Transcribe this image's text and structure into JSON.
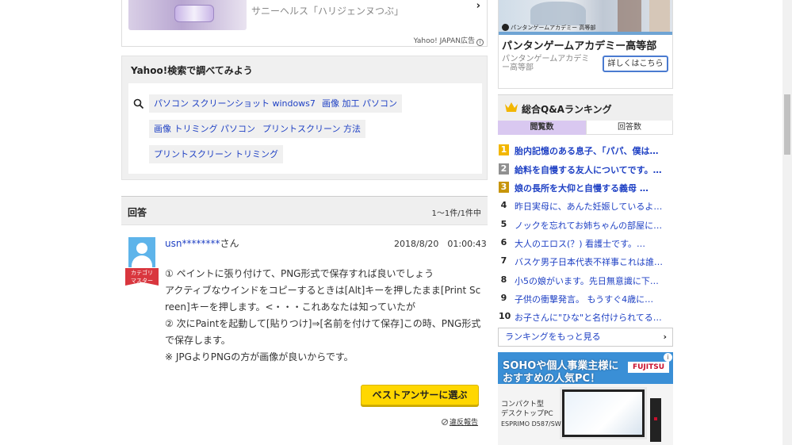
{
  "top_ad": {
    "text": "サニーヘルス「ハリジェンヌつぶ」",
    "label": "Yahoo! JAPAN広告",
    "info": "i"
  },
  "search_suggest": {
    "heading": "Yahoo!検索で調べてみよう",
    "chips": [
      "パソコン スクリーンショット windows7",
      "画像 加工 パソコン",
      "画像 トリミング パソコン",
      "プリントスクリーン 方法",
      "プリントスクリーン トリミング"
    ]
  },
  "answers": {
    "heading": "回答",
    "count": "1〜1件/1件中",
    "item": {
      "badge_line1": "カテゴリ",
      "badge_line2": "マスター",
      "username": "usn********",
      "honorific": "さん",
      "date": "2018/8/20　01:00:43",
      "body_lines": [
        "① ペイントに張り付けて、PNG形式で保存すれば良いでしょう",
        "アクティブなウインドをコピーするときは[Alt]キーを押したまま[Print Sc",
        "reen]キーを押します。<・・・これあなたは知っていたが",
        "② 次にPaintを起動して[貼りつけ]⇒[名前を付けて保存]この時、PNG形式",
        "で保存します。",
        "※ JPGよりPNGの方が画像が良いからです。"
      ],
      "best_answer_button": "ベストアンサーに選ぶ",
      "report_link": "違反報告"
    }
  },
  "right_ad": {
    "small_brand": "パンタンゲームアカデミー 高等部",
    "title": "パンタンゲームアカデミー高等部",
    "subtitle": "パンタンゲームアカデミー高等部",
    "button": "詳しくはこちら"
  },
  "ranking": {
    "title": "総合Q&Aランキング",
    "tabs": [
      "閲覧数",
      "回答数"
    ],
    "items": [
      {
        "rank": "1",
        "text": "胎内記憶のある息子、「パパ、僕は…"
      },
      {
        "rank": "2",
        "text": "給料を自慢する友人についてです。…"
      },
      {
        "rank": "3",
        "text": "娘の長所を大仰と自慢する義母 …"
      },
      {
        "rank": "4",
        "text": "昨日実母に、あんた妊娠しているよ…"
      },
      {
        "rank": "5",
        "text": "ノックを忘れてお姉ちゃんの部屋に…"
      },
      {
        "rank": "6",
        "text": "大人のエロス(？) 看護士です。…"
      },
      {
        "rank": "7",
        "text": "バスケ男子日本代表不祥事これは誰…"
      },
      {
        "rank": "8",
        "text": "小5の娘がいます。先日無意識に下…"
      },
      {
        "rank": "9",
        "text": "子供の衝撃発言。 もうすぐ4歳に…"
      },
      {
        "rank": "10",
        "text": "お子さんに\"ひな\"と名付けられてる…"
      }
    ],
    "more": "ランキングをもっと見る"
  },
  "fujitsu_ad": {
    "line1": "SOHOや個人事業主様に",
    "line2": "おすすめの人気PC！",
    "logo": "FUJITSU",
    "desc1": "コンパクト型",
    "desc2": "デスクトップPC",
    "model": "ESPRIMO D587/SW",
    "info": "i"
  }
}
